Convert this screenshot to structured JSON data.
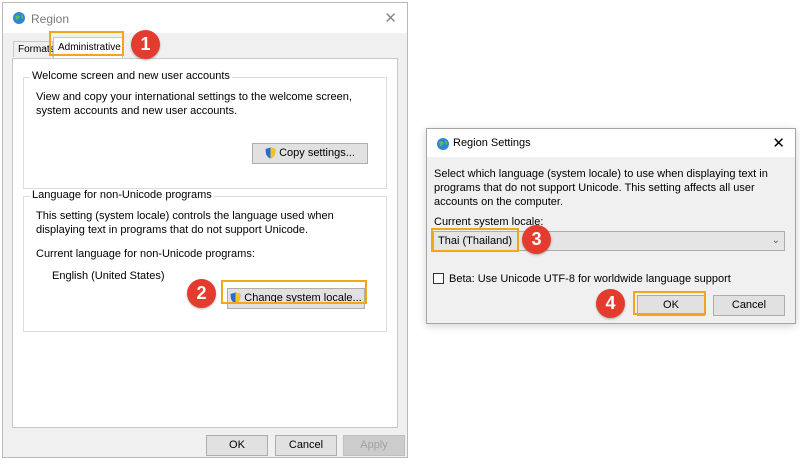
{
  "region_window": {
    "title": "Region",
    "close_glyph": "✕",
    "tabs": [
      {
        "label": "Formats"
      },
      {
        "label": "Administrative"
      }
    ],
    "welcome_group": {
      "legend": "Welcome screen and new user accounts",
      "text": "View and copy your international settings to the welcome screen, system accounts and new user accounts.",
      "copy_button": "Copy settings..."
    },
    "nonunicode_group": {
      "legend": "Language for non-Unicode programs",
      "text": "This setting (system locale) controls the language used when displaying text in programs that do not support Unicode.",
      "current_label": "Current language for non-Unicode programs:",
      "current_value": "English (United States)",
      "change_button": "Change system locale..."
    },
    "footer": {
      "ok": "OK",
      "cancel": "Cancel",
      "apply": "Apply"
    }
  },
  "region_settings_dialog": {
    "title": "Region Settings",
    "close_glyph": "✕",
    "description": "Select which language (system locale) to use when displaying text in programs that do not support Unicode. This setting affects all user accounts on the computer.",
    "locale_label": "Current system locale:",
    "locale_value": "Thai (Thailand)",
    "beta_label": "Beta: Use Unicode UTF-8 for worldwide language support",
    "beta_checked": false,
    "ok": "OK",
    "cancel": "Cancel"
  },
  "step_badges": [
    "1",
    "2",
    "3",
    "4"
  ],
  "colors": {
    "highlight": "#f2a71b",
    "badge": "#e33c2e"
  },
  "icons": [
    "globe-icon",
    "shield-icon",
    "close-icon",
    "chevron-down-icon"
  ]
}
